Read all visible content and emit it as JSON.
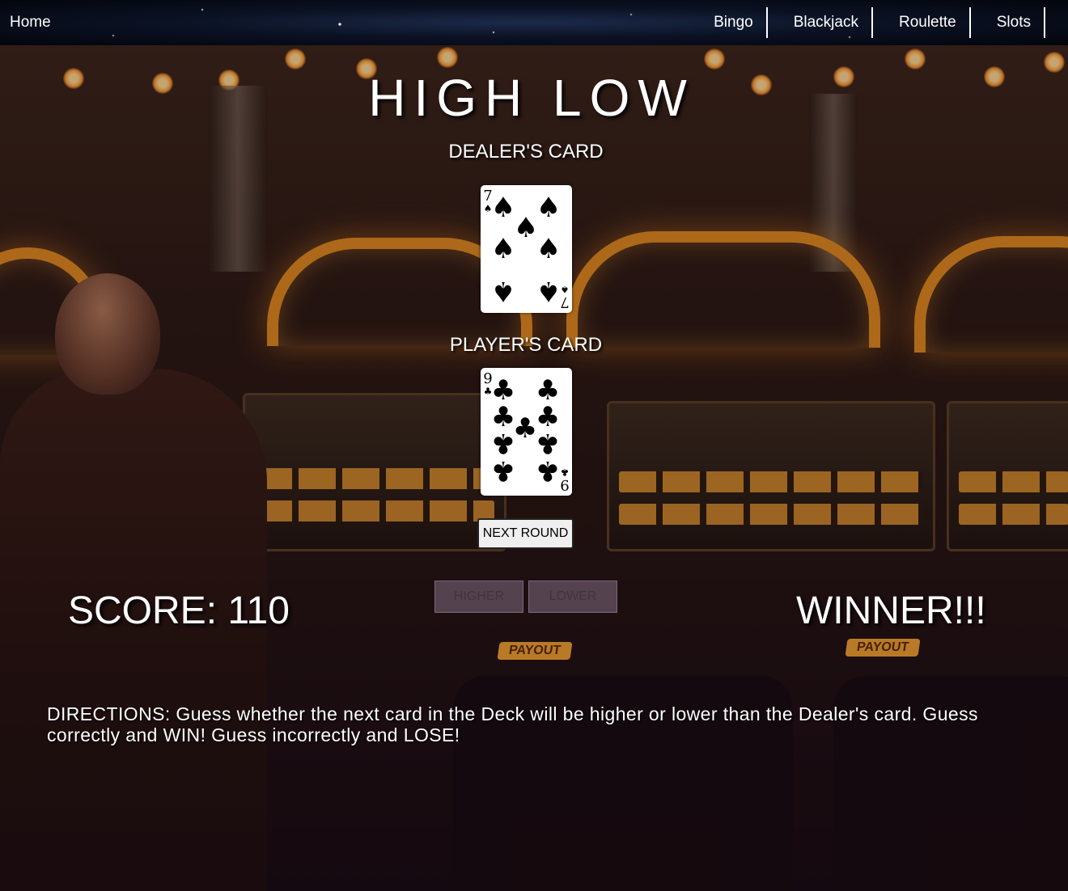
{
  "nav": {
    "home": "Home",
    "links": [
      "Bingo",
      "Blackjack",
      "Roulette",
      "Slots"
    ]
  },
  "game": {
    "title": "HIGH LOW",
    "dealer_label": "DEALER'S CARD",
    "player_label": "PLAYER'S CARD",
    "dealer_card": {
      "rank": "7",
      "suit": "♠",
      "suit_name": "spades"
    },
    "player_card": {
      "rank": "9",
      "suit": "♣",
      "suit_name": "clubs"
    },
    "next_round_label": "NEXT ROUND",
    "higher_label": "HIGHER",
    "lower_label": "LOWER",
    "score_text": "SCORE: 110",
    "result_text": "WINNER!!!",
    "directions": "DIRECTIONS: Guess whether the next card in the Deck will be higher or lower than the Dealer's card. Guess correctly and WIN! Guess incorrectly and LOSE!"
  },
  "colors": {
    "accent_lights": "#e08a1c",
    "card_face": "#ffffff",
    "text": "#ffffff"
  }
}
